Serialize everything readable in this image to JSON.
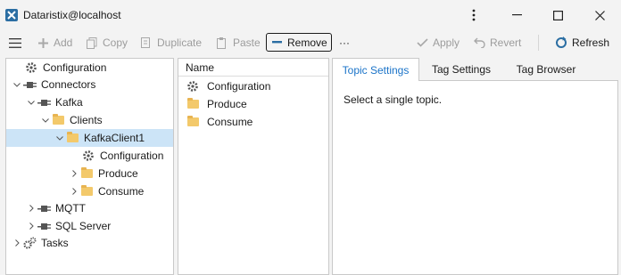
{
  "window": {
    "title": "Dataristix@localhost",
    "menu_icon": "kebab-menu-icon",
    "minimize_icon": "minimize-icon",
    "maximize_icon": "maximize-icon",
    "close_icon": "close-icon"
  },
  "toolbar": {
    "menu_icon": "hamburger-icon",
    "add_label": "Add",
    "copy_label": "Copy",
    "duplicate_label": "Duplicate",
    "paste_label": "Paste",
    "remove_label": "Remove",
    "more_label": "···",
    "apply_label": "Apply",
    "revert_label": "Revert",
    "refresh_label": "Refresh"
  },
  "tree": {
    "items": [
      {
        "label": "Configuration",
        "icon": "gear-icon"
      },
      {
        "label": "Connectors",
        "icon": "plug-icon"
      },
      {
        "label": "Kafka",
        "icon": "plug-icon"
      },
      {
        "label": "Clients",
        "icon": "folder-icon"
      },
      {
        "label": "KafkaClient1",
        "icon": "folder-icon"
      },
      {
        "label": "Configuration",
        "icon": "gear-icon"
      },
      {
        "label": "Produce",
        "icon": "folder-icon"
      },
      {
        "label": "Consume",
        "icon": "folder-icon"
      },
      {
        "label": "MQTT",
        "icon": "plug-icon"
      },
      {
        "label": "SQL Server",
        "icon": "plug-icon"
      },
      {
        "label": "Tasks",
        "icon": "gears-icon"
      }
    ]
  },
  "list": {
    "header": "Name",
    "items": [
      {
        "label": "Configuration",
        "icon": "gear-icon"
      },
      {
        "label": "Produce",
        "icon": "folder-icon"
      },
      {
        "label": "Consume",
        "icon": "folder-icon"
      }
    ]
  },
  "tabs": {
    "items": [
      {
        "label": "Topic Settings"
      },
      {
        "label": "Tag Settings"
      },
      {
        "label": "Tag Browser"
      }
    ],
    "active": "Topic Settings"
  },
  "content": {
    "message": "Select a single topic."
  },
  "colors": {
    "accent": "#1a73c8",
    "selection": "#cce4f7",
    "folder": "#f3c96b"
  }
}
